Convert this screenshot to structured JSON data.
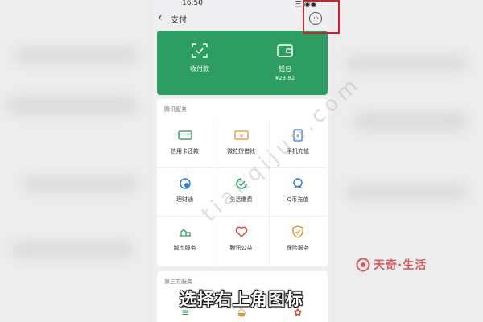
{
  "statusbar": {
    "time": "16:50",
    "signal": "三 ◉◉"
  },
  "header": {
    "title": "支付"
  },
  "green_card": {
    "pay_label": "收付款",
    "wallet_label": "钱包",
    "wallet_balance": "¥23.82"
  },
  "services": {
    "title": "腾讯服务",
    "items": [
      {
        "label": "信用卡还款",
        "icon": "credit-card-icon"
      },
      {
        "label": "微粒贷借钱",
        "icon": "loan-icon"
      },
      {
        "label": "手机充值",
        "icon": "phone-recharge-icon"
      },
      {
        "label": "理财通",
        "icon": "wealth-icon"
      },
      {
        "label": "生活缴费",
        "icon": "utility-icon"
      },
      {
        "label": "Q币充值",
        "icon": "qcoin-icon"
      },
      {
        "label": "城市服务",
        "icon": "city-icon"
      },
      {
        "label": "腾讯公益",
        "icon": "charity-icon"
      },
      {
        "label": "保险服务",
        "icon": "insurance-icon"
      }
    ]
  },
  "third_party": {
    "title": "第三方服务"
  },
  "watermark": "tianqijun.com",
  "caption": "选择右上角图标",
  "brand": {
    "name": "天奇·生活"
  },
  "colors": {
    "green": "#2d9d61",
    "highlight": "#c2272d"
  }
}
